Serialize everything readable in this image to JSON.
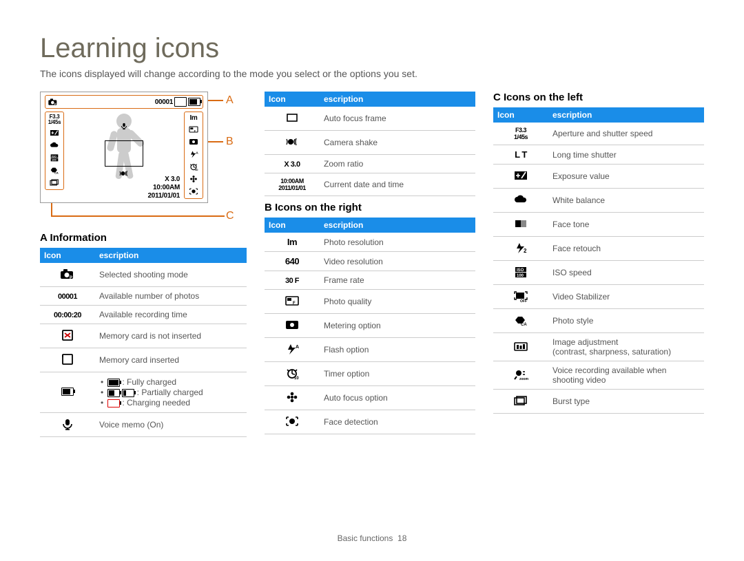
{
  "title": "Learning icons",
  "subtitle": "The icons displayed will change according to the mode you select or the options you set.",
  "footer": {
    "section": "Basic functions",
    "page": "18"
  },
  "callouts": {
    "a": "A",
    "b": "B",
    "c": "C"
  },
  "table_headers": {
    "icon": "Icon",
    "desc": "escription"
  },
  "lcd": {
    "count": "00001",
    "zoom_prefix": "X 3.0",
    "time": "10:00AM",
    "date": "2011/01/01",
    "aperture": "F3.3",
    "shutter": "1/45s"
  },
  "sections": {
    "a_title": "A Information",
    "b1_title": "B Icons on the right",
    "c_title": "C   Icons on the left"
  },
  "a_rows": [
    {
      "icon": "camera-p",
      "label": "",
      "desc": "Selected shooting mode"
    },
    {
      "icon": "",
      "label": "00001",
      "desc": "Available number of photos"
    },
    {
      "icon": "",
      "label": "00:00:20",
      "desc": "Available recording time"
    },
    {
      "icon": "card-x",
      "label": "",
      "desc": "Memory card is not inserted"
    },
    {
      "icon": "card",
      "label": "",
      "desc": "Memory card inserted"
    },
    {
      "icon": "battery",
      "label": "",
      "desc_list": [
        ": Fully charged",
        ": Partially charged",
        ": Charging needed"
      ],
      "desc_list_icons": [
        "batt-full",
        "batt-half",
        "batt-empty"
      ]
    },
    {
      "icon": "mic",
      "label": "",
      "desc": "Voice memo (On)"
    }
  ],
  "b_top_rows": [
    {
      "icon": "frame",
      "desc": "Auto focus frame"
    },
    {
      "icon": "shake",
      "desc": "Camera shake"
    },
    {
      "icon": "",
      "label": "X 3.0",
      "desc": "Zoom ratio",
      "prefix": "[.......]"
    },
    {
      "icon": "",
      "label_top": "10:00AM",
      "label_bot": "2011/01/01",
      "desc": "Current date and time"
    }
  ],
  "b_rows": [
    {
      "icon": "",
      "label": "Im",
      "desc": "Photo resolution",
      "bold": true
    },
    {
      "icon": "",
      "label": "640",
      "desc": "Video resolution",
      "bold": true
    },
    {
      "icon": "framerate",
      "label": "30\nF",
      "desc": "Frame rate"
    },
    {
      "icon": "quality",
      "desc": "Photo quality"
    },
    {
      "icon": "metering",
      "desc": "Metering option"
    },
    {
      "icon": "flash",
      "desc": "Flash option"
    },
    {
      "icon": "timer",
      "desc": "Timer option"
    },
    {
      "icon": "flower",
      "desc": "Auto focus option"
    },
    {
      "icon": "face",
      "desc": "Face detection"
    }
  ],
  "c_rows": [
    {
      "icon": "",
      "label_top": "F3.3",
      "label_bot": "1/45s",
      "desc": "Aperture and shutter speed"
    },
    {
      "icon": "",
      "label": "L T",
      "desc": "Long time shutter",
      "bold": true
    },
    {
      "icon": "ev",
      "desc": "Exposure value"
    },
    {
      "icon": "cloud",
      "desc": "White balance"
    },
    {
      "icon": "facetone",
      "desc": "Face tone"
    },
    {
      "icon": "retouch",
      "desc": "Face retouch"
    },
    {
      "icon": "iso",
      "desc": "ISO speed"
    },
    {
      "icon": "stabilizer",
      "desc": "Video Stabilizer"
    },
    {
      "icon": "style",
      "desc": "Photo style"
    },
    {
      "icon": "adjust",
      "desc": "Image adjustment\n(contrast, sharpness, saturation)"
    },
    {
      "icon": "voice-zoom",
      "desc": "Voice recording available when shooting video"
    },
    {
      "icon": "burst",
      "desc": "Burst type"
    }
  ]
}
